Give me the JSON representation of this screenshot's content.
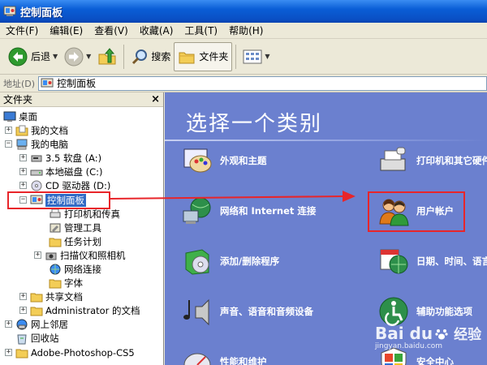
{
  "window": {
    "title": "控制面板"
  },
  "menu": [
    "文件(F)",
    "编辑(E)",
    "查看(V)",
    "收藏(A)",
    "工具(T)",
    "帮助(H)"
  ],
  "toolbar": {
    "back": "后退",
    "search": "搜索",
    "folders": "文件夹"
  },
  "address": {
    "label": "地址(D)",
    "value": "控制面板"
  },
  "folders_pane": {
    "title": "文件夹",
    "items": [
      "桌面",
      "我的文档",
      "我的电脑",
      "3.5 软盘 (A:)",
      "本地磁盘 (C:)",
      "CD 驱动器 (D:)",
      "控制面板",
      "打印机和传真",
      "管理工具",
      "任务计划",
      "扫描仪和照相机",
      "网络连接",
      "字体",
      "共享文档",
      "Administrator 的文档",
      "网上邻居",
      "回收站",
      "Adobe-Photoshop-CS5"
    ]
  },
  "main": {
    "heading": "选择一个类别",
    "categories": [
      "外观和主题",
      "打印机和其它硬件",
      "网络和 Internet 连接",
      "用户帐户",
      "添加/删除程序",
      "日期、时间、语言和区域设置",
      "声音、语音和音频设备",
      "辅助功能选项",
      "性能和维护",
      "安全中心"
    ]
  },
  "watermark": {
    "brand": "Bai du",
    "sub": "经验",
    "url": "jingyan.baidu.com"
  },
  "colors": {
    "titlebar": "#0a5ed6",
    "main_bg": "#6b80cf",
    "highlight": "#e8252a",
    "selection": "#316ac5"
  }
}
